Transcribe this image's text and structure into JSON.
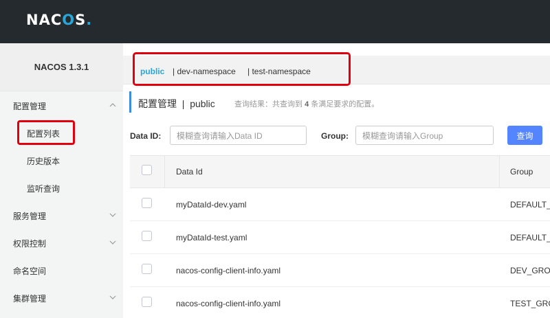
{
  "header": {
    "logo_prefix": "NAC",
    "logo_o": "O",
    "logo_suffix": "S",
    "logo_dot": "."
  },
  "sidebar": {
    "version": "NACOS 1.3.1",
    "items": [
      {
        "label": "配置管理"
      },
      {
        "label": "配置列表"
      },
      {
        "label": "历史版本"
      },
      {
        "label": "监听查询"
      },
      {
        "label": "服务管理"
      },
      {
        "label": "权限控制"
      },
      {
        "label": "命名空间"
      },
      {
        "label": "集群管理"
      }
    ]
  },
  "namespaces": [
    {
      "label": "public"
    },
    {
      "label": "| dev-namespace"
    },
    {
      "label": "| test-namespace"
    }
  ],
  "page": {
    "title": "配置管理  |  public",
    "query_result_prefix": "查询结果：共查询到",
    "query_count": "4",
    "query_result_suffix": "条满足要求的配置。"
  },
  "filters": {
    "dataid_label": "Data ID:",
    "dataid_placeholder": "模糊查询请输入Data ID",
    "group_label": "Group:",
    "group_placeholder": "模糊查询请输入Group",
    "query_button": "查询"
  },
  "table": {
    "columns": [
      "Data Id",
      "Group"
    ],
    "rows": [
      {
        "data_id": "myDataId-dev.yaml",
        "group": "DEFAULT_"
      },
      {
        "data_id": "myDataId-test.yaml",
        "group": "DEFAULT_"
      },
      {
        "data_id": "nacos-config-client-info.yaml",
        "group": "DEV_GROU"
      },
      {
        "data_id": "nacos-config-client-info.yaml",
        "group": "TEST_GRO"
      }
    ]
  },
  "colors": {
    "accent": "#29a6d8",
    "button": "#5584ff",
    "highlight": "#e0000d",
    "topbar": "#252a2f"
  }
}
